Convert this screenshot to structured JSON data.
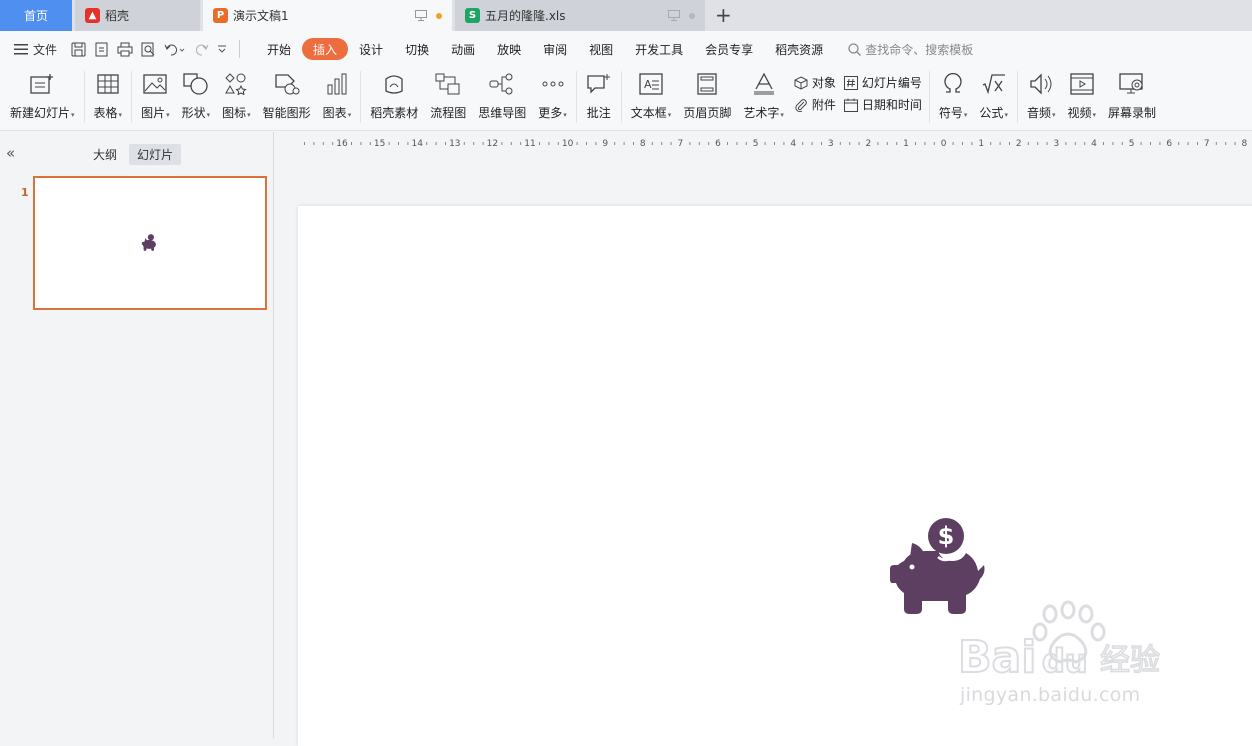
{
  "tabs": {
    "home": "首页",
    "daoke": "稻壳",
    "doc": "演示文稿1",
    "xls": "五月的隆隆.xls"
  },
  "menubar": {
    "file": "文件",
    "items": [
      "开始",
      "插入",
      "设计",
      "切换",
      "动画",
      "放映",
      "审阅",
      "视图",
      "开发工具",
      "会员专享",
      "稻壳资源"
    ],
    "active": "插入",
    "search_placeholder": "查找命令、搜索模板"
  },
  "ribbon": {
    "new_slide": "新建幻灯片",
    "table": "表格",
    "picture": "图片",
    "shape": "形状",
    "icon": "图标",
    "smart_shape": "智能图形",
    "chart": "图表",
    "daoke_material": "稻壳素材",
    "flowchart": "流程图",
    "mindmap": "思维导图",
    "more": "更多",
    "comment": "批注",
    "textbox": "文本框",
    "header_footer": "页眉页脚",
    "wordart": "艺术字",
    "object": "对象",
    "attachment": "附件",
    "slide_number": "幻灯片编号",
    "datetime": "日期和时间",
    "symbol": "符号",
    "formula": "公式",
    "audio": "音频",
    "video": "视频",
    "screen_record": "屏幕录制"
  },
  "leftpanel": {
    "outline": "大纲",
    "slides": "幻灯片",
    "slide_number": "1"
  },
  "ruler": {
    "labels": [
      "16",
      "15",
      "14",
      "13",
      "12",
      "11",
      "10",
      "9",
      "8",
      "7",
      "6",
      "5",
      "4",
      "3",
      "2",
      "1",
      "0",
      "1",
      "2",
      "3",
      "4",
      "5",
      "6",
      "7",
      "8"
    ]
  },
  "watermark": {
    "text": "jingyan.baidu.com"
  },
  "colors": {
    "accent": "#ee6d3f",
    "home_tab": "#4e8ff0",
    "pig": "#5d3f61",
    "thumb_border": "#d9723c"
  }
}
